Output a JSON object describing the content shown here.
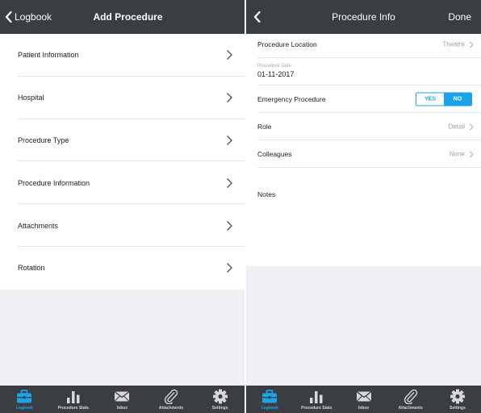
{
  "left": {
    "navbar": {
      "back_label": "Logbook",
      "title": "Add Procedure"
    },
    "menu_items": [
      {
        "label": "Patient Information"
      },
      {
        "label": "Hospital"
      },
      {
        "label": "Procedure Type"
      },
      {
        "label": "Procedure Information"
      },
      {
        "label": "Attachments"
      },
      {
        "label": "Rotation"
      }
    ]
  },
  "right": {
    "navbar": {
      "title": "Procedure Info",
      "done_label": "Done"
    },
    "procedure_location": {
      "label": "Procedure Location",
      "value": "Theatre"
    },
    "procedure_date": {
      "label": "Procedure Date",
      "value": "01-11-2017"
    },
    "emergency_procedure": {
      "label": "Emergency Procedure",
      "yes_label": "YES",
      "no_label": "NO",
      "selected": "NO"
    },
    "role": {
      "label": "Role",
      "value": "Detail"
    },
    "colleagues": {
      "label": "Colleagues",
      "value": "None"
    },
    "notes": {
      "label": "Notes"
    }
  },
  "tabbar": {
    "active": "Logbook",
    "tabs": [
      {
        "label": "Logbook",
        "icon": "briefcase-icon"
      },
      {
        "label": "Procedure Stats",
        "icon": "bar-chart-icon"
      },
      {
        "label": "Inbox",
        "icon": "envelope-icon"
      },
      {
        "label": "Attachments",
        "icon": "paperclip-icon"
      },
      {
        "label": "Settings",
        "icon": "gear-icon"
      }
    ]
  },
  "colors": {
    "navbar": "#3a3d42",
    "accent": "#1aa3e8",
    "grey_background": "#efeff4"
  }
}
